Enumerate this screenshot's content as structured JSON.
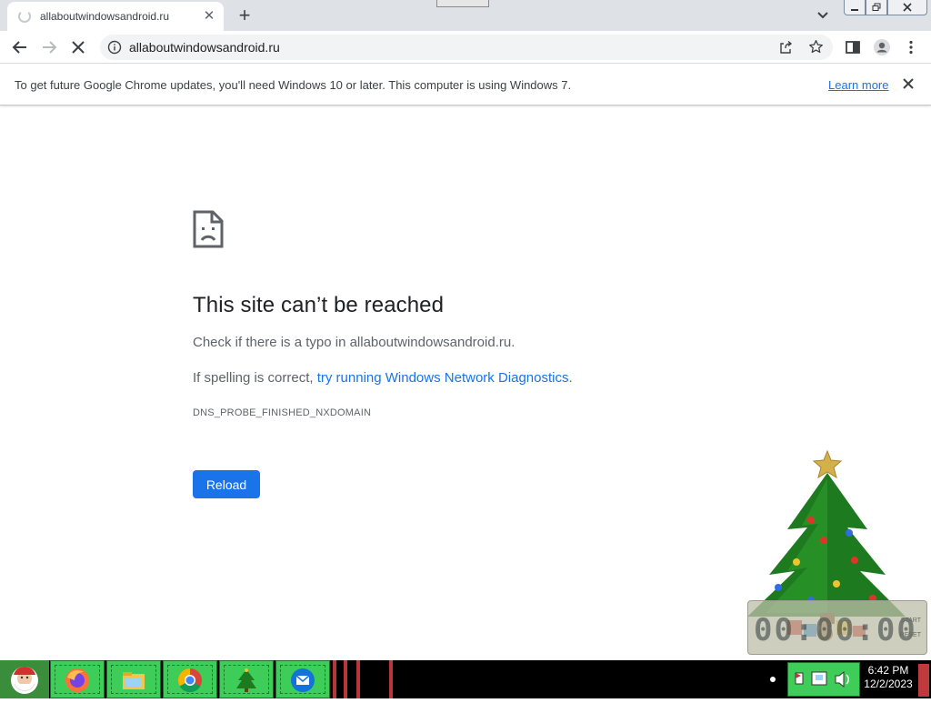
{
  "browser": {
    "tab": {
      "title": "allaboutwindowsandroid.ru",
      "close_glyph": "✕"
    },
    "new_tab_glyph": "+",
    "omnibox": {
      "url": "allaboutwindowsandroid.ru"
    }
  },
  "infobar": {
    "message": "To get future Google Chrome updates, you'll need Windows 10 or later. This computer is using Windows 7.",
    "link": "Learn more"
  },
  "error_page": {
    "title": "This site can’t be reached",
    "line1": "Check if there is a typo in allaboutwindowsandroid.ru.",
    "line2_prefix": "If spelling is correct, ",
    "line2_link": "try running Windows Network Diagnostics",
    "line2_suffix": ".",
    "error_code": "DNS_PROBE_FINISHED_NXDOMAIN",
    "reload_label": "Reload"
  },
  "widget": {
    "digits": "00:00:00",
    "start_label": "START",
    "reset_label": "RESET"
  },
  "taskbar": {
    "apps": [
      "start-santa-icon",
      "firefox-icon",
      "file-explorer-icon",
      "chrome-icon",
      "christmas-tree-icon",
      "thunderbird-icon"
    ],
    "time": "6:42 PM",
    "date": "12/2/2023"
  },
  "colors": {
    "accent": "#1a73e8",
    "taskbar_green": "#3dcd58",
    "tabstrip": "#dee1e6"
  }
}
